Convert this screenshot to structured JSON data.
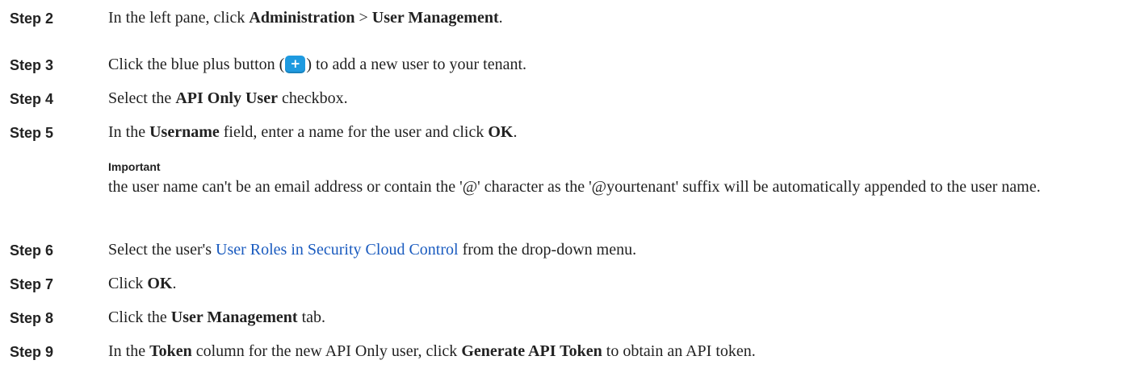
{
  "steps": [
    {
      "label": "Step 2",
      "parts": [
        "In the left pane, click ",
        "Administration",
        " > ",
        "User Management",
        "."
      ]
    },
    {
      "label": "Step 3",
      "before": "Click the blue plus button (",
      "plus": "+",
      "after": ") to add a new user to your tenant."
    },
    {
      "label": "Step 4",
      "parts": [
        "Select the ",
        "API Only User",
        " checkbox."
      ]
    },
    {
      "label": "Step 5",
      "parts": [
        "In the ",
        "Username",
        " field, enter a name for the user and click ",
        "OK",
        "."
      ]
    },
    {
      "label": "Step 6",
      "before": "Select the user's ",
      "link": "User Roles in Security Cloud Control",
      "after": " from the drop-down menu."
    },
    {
      "label": "Step 7",
      "parts": [
        "Click ",
        "OK",
        "."
      ]
    },
    {
      "label": "Step 8",
      "parts": [
        "Click the ",
        "User Management",
        " tab."
      ]
    },
    {
      "label": "Step 9",
      "parts": [
        "In the ",
        "Token",
        " column for the new API Only user, click ",
        "Generate API Token",
        " to obtain an API token."
      ]
    }
  ],
  "note": {
    "title": "Important",
    "body": "the user name can't be an email address or contain the '@' character as the '@yourtenant' suffix will be automatically appended to the user name."
  },
  "icons": {
    "plus_button": "plus-icon",
    "plus_color": "#1e9ae0"
  }
}
